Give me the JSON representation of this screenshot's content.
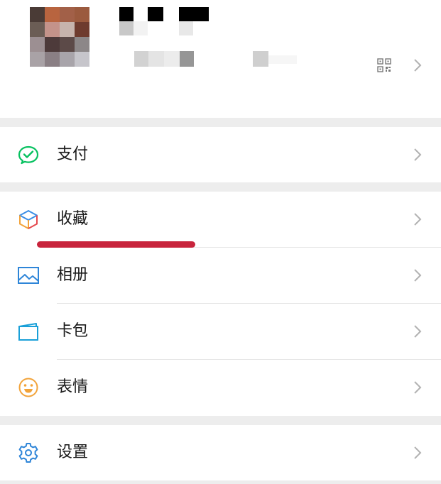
{
  "menu": {
    "pay": {
      "label": "支付",
      "icon": "wechat-pay-icon",
      "color": "#07c160"
    },
    "favorites": {
      "label": "收藏",
      "icon": "cube-icon"
    },
    "album": {
      "label": "相册",
      "icon": "photo-icon",
      "color": "#2e85d8"
    },
    "cards": {
      "label": "卡包",
      "icon": "card-icon",
      "color": "#1aa0d8"
    },
    "stickers": {
      "label": "表情",
      "icon": "smiley-icon",
      "color": "#f2a33a"
    },
    "settings": {
      "label": "设置",
      "icon": "gear-icon",
      "color": "#2e85d8"
    }
  },
  "profile": {
    "qr_icon": "qr-code-icon"
  },
  "annotation": {
    "underline_color": "#c8243c"
  }
}
